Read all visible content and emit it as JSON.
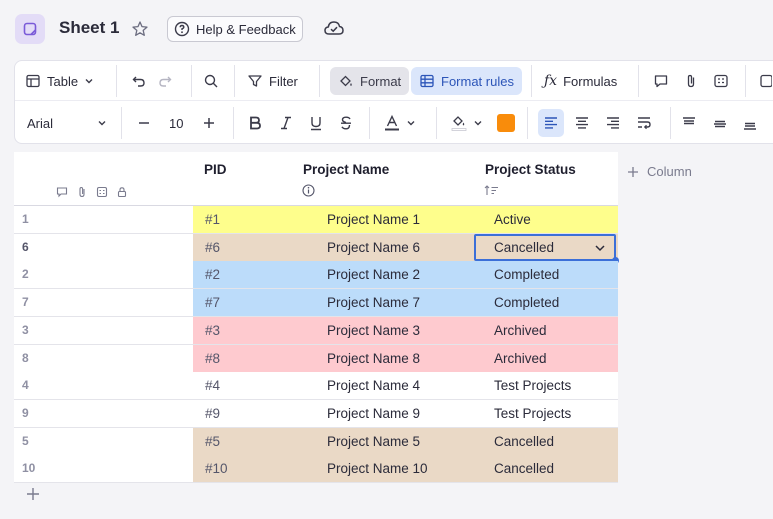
{
  "header": {
    "sheet_title": "Sheet 1",
    "help_label": "Help & Feedback"
  },
  "toolbar": {
    "view_label": "Table",
    "filter_label": "Filter",
    "format_label": "Format",
    "format_rules_label": "Format rules",
    "formulas_label": "Formulas",
    "font_family": "Arial",
    "font_size": "10",
    "fill_swatch_color": "#f98c0b"
  },
  "columns": {
    "pid": "PID",
    "name": "Project Name",
    "status": "Project Status",
    "add_column": "Column"
  },
  "rows": [
    {
      "num": "1",
      "pid": "#1",
      "name": "Project Name 1",
      "status": "Active",
      "color": "#fefe8c"
    },
    {
      "num": "6",
      "pid": "#6",
      "name": "Project Name 6",
      "status": "Cancelled",
      "color": "#ead9c6"
    },
    {
      "num": "2",
      "pid": "#2",
      "name": "Project Name 2",
      "status": "Completed",
      "color": "#bcdcfa"
    },
    {
      "num": "7",
      "pid": "#7",
      "name": "Project Name 7",
      "status": "Completed",
      "color": "#bcdcfa"
    },
    {
      "num": "3",
      "pid": "#3",
      "name": "Project Name 3",
      "status": "Archived",
      "color": "#fecacf"
    },
    {
      "num": "8",
      "pid": "#8",
      "name": "Project Name 8",
      "status": "Archived",
      "color": "#fecacf"
    },
    {
      "num": "4",
      "pid": "#4",
      "name": "Project Name 4",
      "status": "Test Projects",
      "color": "#ffffff"
    },
    {
      "num": "9",
      "pid": "#9",
      "name": "Project Name 9",
      "status": "Test Projects",
      "color": "#ffffff"
    },
    {
      "num": "5",
      "pid": "#5",
      "name": "Project Name 5",
      "status": "Cancelled",
      "color": "#ead9c6"
    },
    {
      "num": "10",
      "pid": "#10",
      "name": "Project Name 10",
      "status": "Cancelled",
      "color": "#ead9c6"
    }
  ],
  "selected_row": "6",
  "icons": {
    "app": "sheet-app-icon",
    "favorite": "star-icon",
    "help": "help-circle-icon",
    "sync": "cloud-check-icon"
  }
}
